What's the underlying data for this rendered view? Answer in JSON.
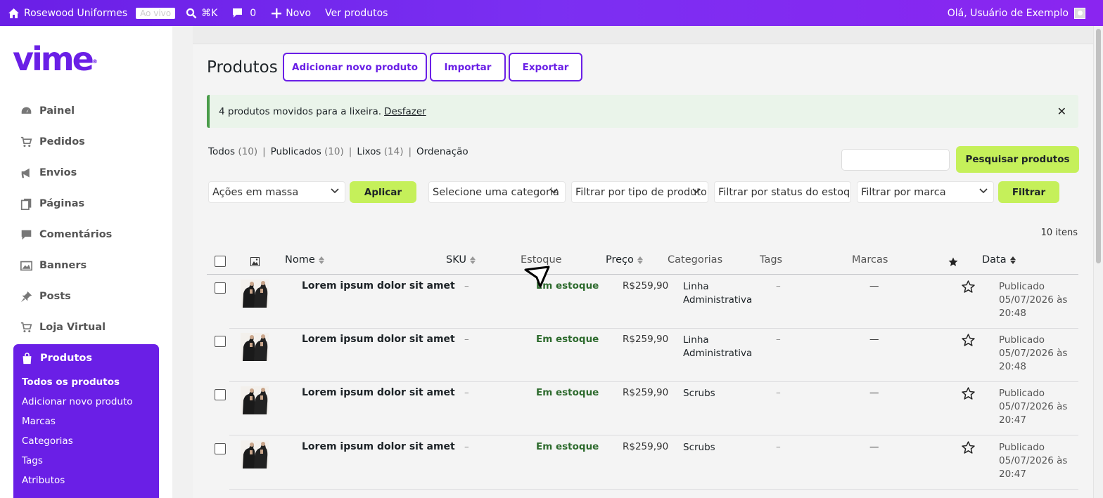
{
  "adminbar": {
    "site_name": "Rosewood Uniformes",
    "live_badge": "Ao vivo",
    "search_shortcut": "⌘K",
    "comments_count": "0",
    "new_label": "Novo",
    "view_products": "Ver produtos",
    "greeting": "Olá, Usuário de Exemplo"
  },
  "brand": {
    "logo_text": "vime",
    "accent": "#6a1fe6",
    "lime": "#c5f05a"
  },
  "sidebar": {
    "items": [
      {
        "label": "Painel",
        "icon": "dashboard-icon"
      },
      {
        "label": "Pedidos",
        "icon": "cart-icon"
      },
      {
        "label": "Envios",
        "icon": "megaphone-icon"
      },
      {
        "label": "Páginas",
        "icon": "pages-icon"
      },
      {
        "label": "Comentários",
        "icon": "comment-icon"
      },
      {
        "label": "Banners",
        "icon": "image-icon"
      },
      {
        "label": "Posts",
        "icon": "pin-icon"
      },
      {
        "label": "Loja Virtual",
        "icon": "cart-icon"
      }
    ],
    "active": {
      "label": "Produtos",
      "submenu": [
        "Todos os produtos",
        "Adicionar novo produto",
        "Marcas",
        "Categorias",
        "Tags",
        "Atributos"
      ]
    }
  },
  "page": {
    "title": "Produtos",
    "buttons": [
      "Adicionar novo produto",
      "Importar",
      "Exportar"
    ],
    "notice": {
      "text": "4 produtos movidos para a lixeira.",
      "link": "Desfazer"
    },
    "views": [
      {
        "label": "Todos",
        "count": "(10)"
      },
      {
        "label": "Publicados",
        "count": "(10)"
      },
      {
        "label": "Lixos",
        "count": "(14)"
      },
      {
        "label": "Ordenação",
        "count": ""
      }
    ],
    "search_button": "Pesquisar produtos",
    "bulk_actions": "Ações em massa",
    "apply": "Aplicar",
    "filters": [
      "Selecione uma categoria",
      "Filtrar por tipo de produto",
      "Filtrar por status do estoque",
      "Filtrar por marca"
    ],
    "filter_button": "Filtrar",
    "items_count": "10 itens"
  },
  "table": {
    "headers": [
      "Nome",
      "SKU",
      "Estoque",
      "Preço",
      "Categorias",
      "Tags",
      "Marcas",
      "Data"
    ],
    "rows": [
      {
        "name": "Lorem ipsum dolor sit amet",
        "sku": "–",
        "stock": "Em estoque",
        "price": "R$259,90",
        "category": "Linha Administrativa",
        "tags": "–",
        "brands": "—",
        "status": "Publicado",
        "date": "05/07/2026 às",
        "time": "20:48"
      },
      {
        "name": "Lorem ipsum dolor sit amet",
        "sku": "–",
        "stock": "Em estoque",
        "price": "R$259,90",
        "category": "Linha Administrativa",
        "tags": "–",
        "brands": "—",
        "status": "Publicado",
        "date": "05/07/2026 às",
        "time": "20:48"
      },
      {
        "name": "Lorem ipsum dolor sit amet",
        "sku": "–",
        "stock": "Em estoque",
        "price": "R$259,90",
        "category": "Scrubs",
        "tags": "–",
        "brands": "—",
        "status": "Publicado",
        "date": "05/07/2026 às",
        "time": "20:47"
      },
      {
        "name": "Lorem ipsum dolor sit amet",
        "sku": "–",
        "stock": "Em estoque",
        "price": "R$259,90",
        "category": "Scrubs",
        "tags": "–",
        "brands": "—",
        "status": "Publicado",
        "date": "05/07/2026 às",
        "time": "20:47"
      }
    ]
  }
}
